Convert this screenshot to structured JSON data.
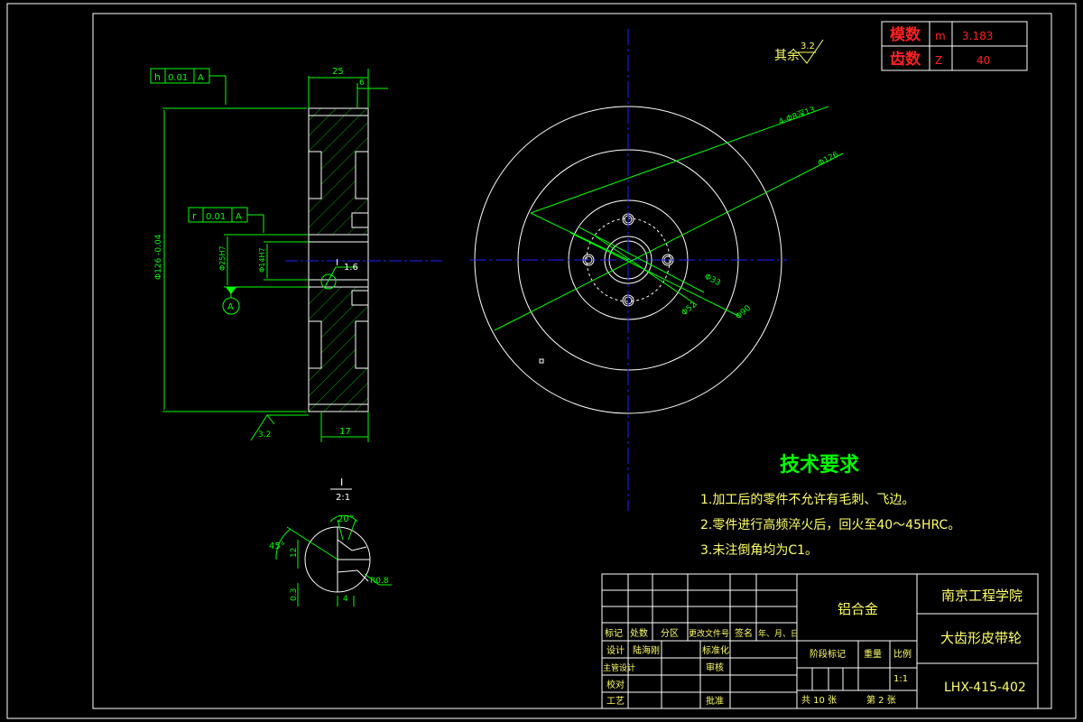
{
  "colors": {
    "background": "#000000",
    "frame": "#ffffff",
    "dimension": "#00ff00",
    "centerline": "#2020ff",
    "hatch": "#00cc00",
    "accent_red": "#ff2020",
    "text_yellow": "#ffff66",
    "title_text": "#00ff00"
  },
  "param_table": {
    "rows": [
      {
        "label": "模数",
        "symbol": "m",
        "value": "3.183"
      },
      {
        "label": "齿数",
        "symbol": "Z",
        "value": "40"
      }
    ]
  },
  "surface_note": {
    "text": "其余",
    "roughness": "3.2"
  },
  "section_view": {
    "tolerance_top": {
      "symbol": "h",
      "value": "0.01",
      "datum": "A"
    },
    "tolerance_mid": {
      "symbol": "r",
      "value": "0.01",
      "datum": "A"
    },
    "dim_width": "25",
    "dim_small": "6",
    "dim_bottom": "17",
    "dim_dia": "Φ126 -0.04",
    "dim_bore1": "Φ25H7",
    "dim_bore2": "Φ14H7",
    "roughness_bore": "1.6",
    "roughness_bottom": "3.2",
    "detail_callout": "I",
    "datum_label": "A"
  },
  "front_view": {
    "dim_holes": "4-Φ8深13",
    "dim_outer": "Φ126",
    "dim_d33": "Φ33",
    "dim_d52": "Φ52",
    "dim_d90": "Φ90"
  },
  "detail_view": {
    "label": "I",
    "scale": "2:1",
    "angle_20": "20°",
    "angle_45": "45°",
    "dim_12": "12",
    "dim_03": "0.3",
    "dim_4": "4",
    "radius": "R0.8"
  },
  "tech_requirements": {
    "title": "技术要求",
    "items": [
      "1.加工后的零件不允许有毛刺、飞边。",
      "2.零件进行高频淬火后，回火至40～45HRC。",
      "3.未注倒角均为C1。"
    ]
  },
  "title_block": {
    "material": "铝合金",
    "school": "南京工程学院",
    "part_name": "大齿形皮带轮",
    "drawing_no": "LHX-415-402",
    "scale": "1:1",
    "headers": {
      "mark": "标记",
      "count": "处数",
      "zone": "分区",
      "change_doc": "更改文件号",
      "sign": "签名",
      "date": "年、月、日",
      "design": "设计",
      "designer": "陆海刚",
      "standard": "标准化",
      "stage_mark": "阶段标记",
      "weight": "重量",
      "ratio": "比例",
      "chief": "主管设计",
      "review": "审核",
      "check": "校对",
      "process": "工艺",
      "approve": "批准",
      "sheets_total": "共  10  张",
      "sheet_no": "第  2  张"
    }
  }
}
